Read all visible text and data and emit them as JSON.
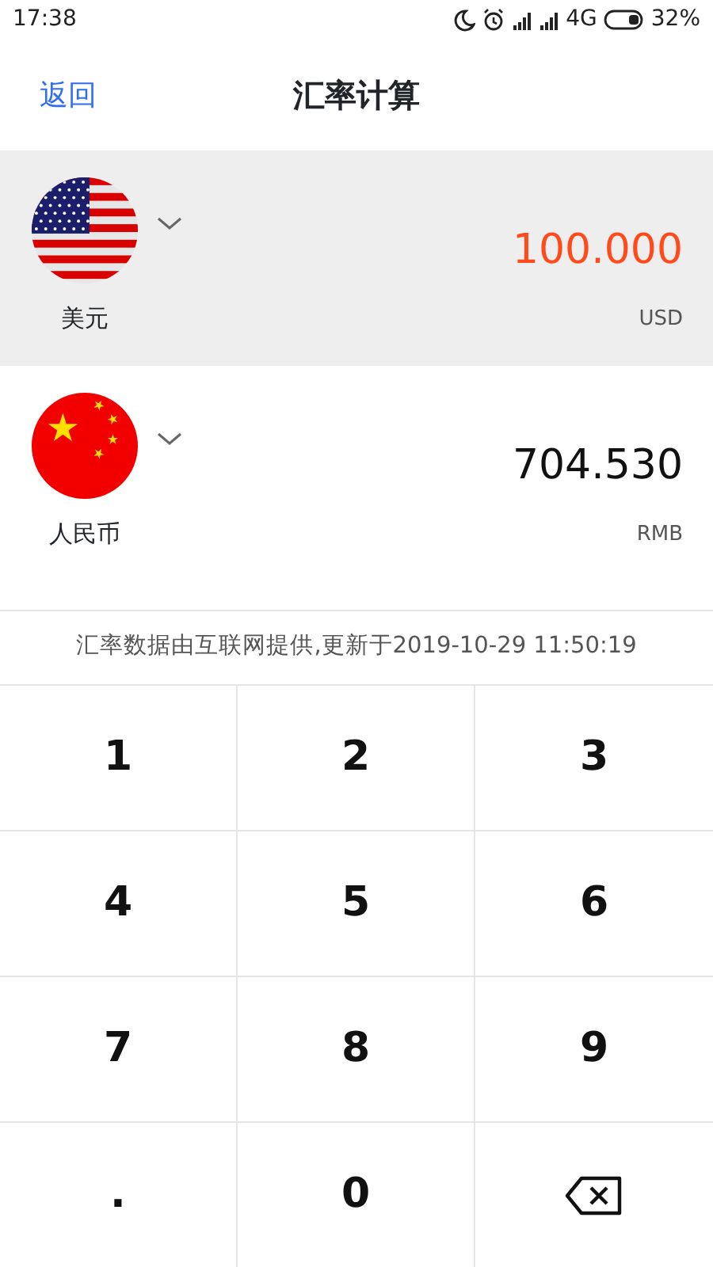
{
  "status_bar": {
    "time": "17:38",
    "network": "4G",
    "battery": "32%"
  },
  "header": {
    "back": "返回",
    "title": "汇率计算"
  },
  "currencies": [
    {
      "kind": "us",
      "name": "美元",
      "amount": "100.000",
      "code": "USD",
      "selected": true
    },
    {
      "kind": "cn",
      "name": "人民币",
      "amount": "704.530",
      "code": "RMB",
      "selected": false
    }
  ],
  "note": "汇率数据由互联网提供,更新于2019-10-29 11:50:19",
  "keys": [
    {
      "kind": "digit",
      "label": "1"
    },
    {
      "kind": "digit",
      "label": "2"
    },
    {
      "kind": "digit",
      "label": "3"
    },
    {
      "kind": "digit",
      "label": "4"
    },
    {
      "kind": "digit",
      "label": "5"
    },
    {
      "kind": "digit",
      "label": "6"
    },
    {
      "kind": "digit",
      "label": "7"
    },
    {
      "kind": "digit",
      "label": "8"
    },
    {
      "kind": "digit",
      "label": "9"
    },
    {
      "kind": "digit",
      "label": "."
    },
    {
      "kind": "digit",
      "label": "0"
    },
    {
      "kind": "backspace"
    }
  ]
}
